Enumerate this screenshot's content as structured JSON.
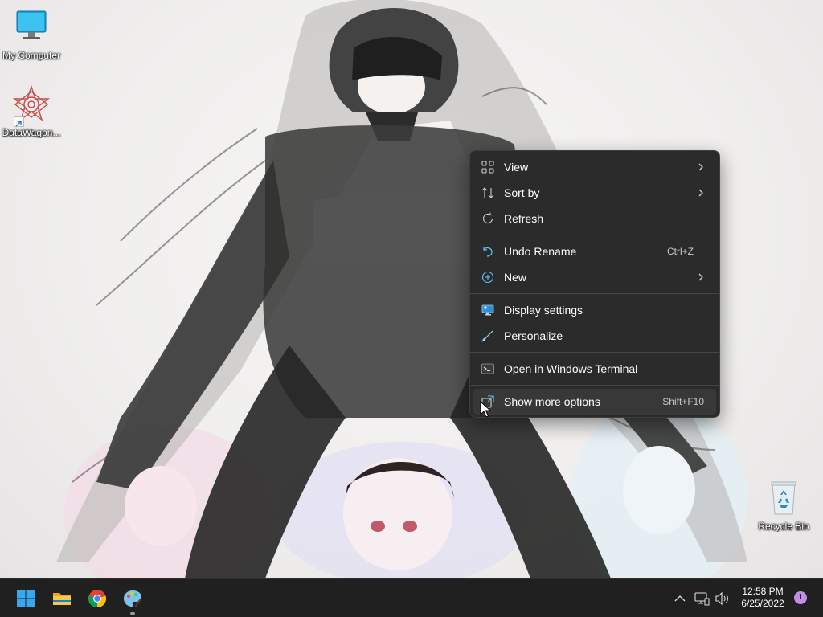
{
  "desktop": {
    "icons": [
      {
        "label": "My Computer",
        "icon": "monitor-icon"
      },
      {
        "label": "DataWagon...",
        "icon": "datawagon-icon"
      },
      {
        "label": "Recycle Bin",
        "icon": "recycle-bin-icon"
      }
    ]
  },
  "context_menu": {
    "items": [
      {
        "label": "View",
        "icon": "grid-icon",
        "submenu": true
      },
      {
        "label": "Sort by",
        "icon": "sort-icon",
        "submenu": true
      },
      {
        "label": "Refresh",
        "icon": "refresh-icon"
      },
      {
        "label": "Undo Rename",
        "icon": "undo-icon",
        "shortcut": "Ctrl+Z"
      },
      {
        "label": "New",
        "icon": "add-circle-icon",
        "submenu": true
      },
      {
        "label": "Display settings",
        "icon": "display-icon"
      },
      {
        "label": "Personalize",
        "icon": "brush-icon"
      },
      {
        "label": "Open in Windows Terminal",
        "icon": "terminal-icon"
      },
      {
        "label": "Show more options",
        "icon": "expand-icon",
        "shortcut": "Shift+F10",
        "hovered": true
      }
    ]
  },
  "taskbar": {
    "apps": [
      {
        "name": "Start",
        "icon": "windows-start-icon"
      },
      {
        "name": "File Explorer",
        "icon": "folder-icon"
      },
      {
        "name": "Google Chrome",
        "icon": "chrome-icon"
      },
      {
        "name": "Paint",
        "icon": "paint-icon",
        "running": true
      }
    ],
    "tray": {
      "time": "12:58 PM",
      "date": "6/25/2022",
      "notifications": "1"
    }
  },
  "colors": {
    "menu_bg": "#2b2b2b",
    "taskbar_bg": "#202020",
    "accent": "#0078d4",
    "notification_badge": "#c28ee6"
  }
}
